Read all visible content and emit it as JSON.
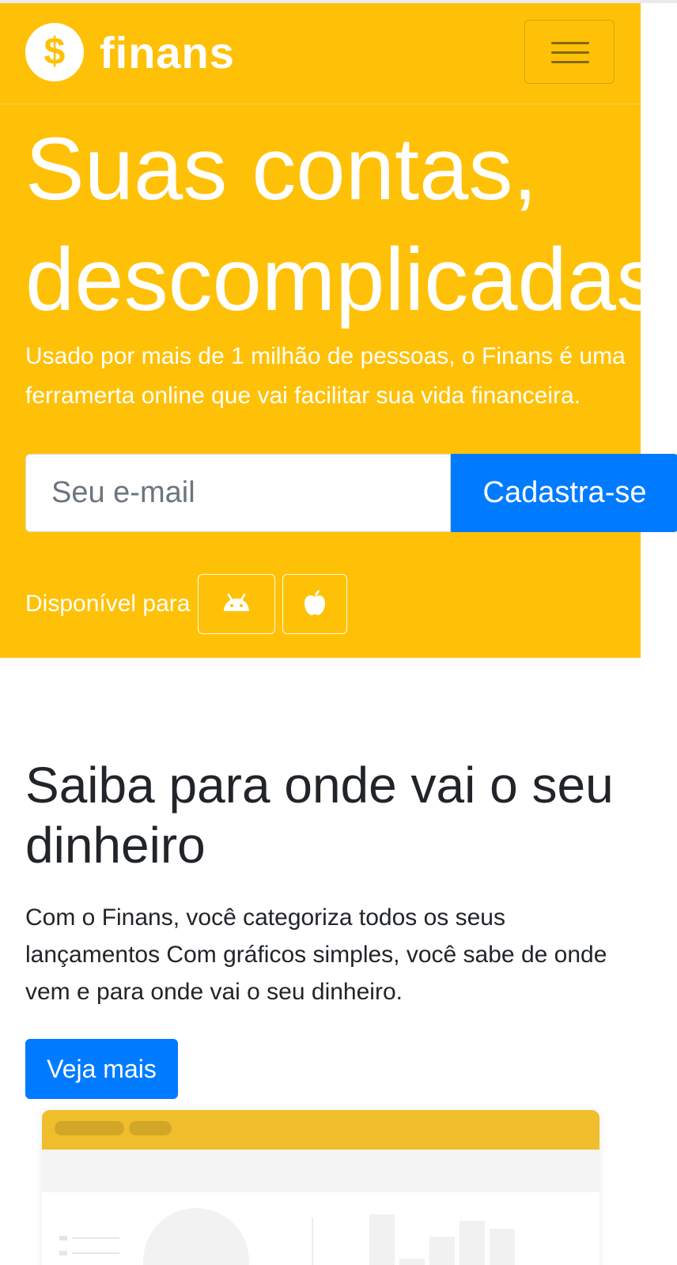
{
  "brand": {
    "logo_symbol": "$",
    "name": "finans",
    "color": "#ffc107"
  },
  "nav": {
    "toggle_icon": "hamburger-menu-icon"
  },
  "hero": {
    "title_line1": "Suas contas,",
    "title_line2": "descomplicadas",
    "subtitle": "Usado por mais de 1 milhão de pessoas, o Finans é uma ferramerta online que vai facilitar sua vida financeira.",
    "email_placeholder": "Seu e-mail",
    "signup_label": "Cadastra-se",
    "available_label": "Disponível para",
    "platform_icons": [
      "android-icon",
      "apple-icon"
    ]
  },
  "section": {
    "title": "Saiba para onde vai o seu dinheiro",
    "text": "Com o Finans, você categoriza todos os seus lançamentos Com gráficos simples, você sabe de onde vem e para onde vai o seu dinheiro.",
    "button_label": "Veja mais"
  },
  "colors": {
    "primary": "#007bff",
    "hero_bg": "#ffc107",
    "text_dark": "#212529"
  }
}
